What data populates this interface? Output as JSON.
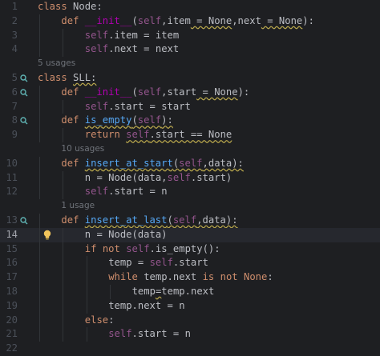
{
  "editor": {
    "lines": [
      {
        "kind": "code",
        "num": "1",
        "marker": false,
        "indent": 0,
        "tokens": [
          {
            "t": "class",
            "c": "kw"
          },
          {
            "t": " Node:"
          }
        ]
      },
      {
        "kind": "code",
        "num": "2",
        "marker": false,
        "indent": 1,
        "tokens": [
          {
            "t": "def",
            "c": "kw"
          },
          {
            "t": " "
          },
          {
            "t": "__init__",
            "c": "magic"
          },
          {
            "t": "("
          },
          {
            "t": "self",
            "c": "self"
          },
          {
            "t": ",item"
          },
          {
            "t": " = None",
            "c": "warn"
          },
          {
            "t": ",next"
          },
          {
            "t": " = None",
            "c": "warn"
          },
          {
            "t": "):"
          }
        ]
      },
      {
        "kind": "code",
        "num": "3",
        "marker": false,
        "indent": 2,
        "tokens": [
          {
            "t": "self",
            "c": "self"
          },
          {
            "t": ".item = item"
          }
        ]
      },
      {
        "kind": "code",
        "num": "4",
        "marker": false,
        "indent": 2,
        "tokens": [
          {
            "t": "self",
            "c": "self"
          },
          {
            "t": ".next = next"
          }
        ]
      },
      {
        "kind": "hint",
        "text": "5 usages",
        "indent": 0
      },
      {
        "kind": "code",
        "num": "5",
        "marker": true,
        "indent": 0,
        "tokens": [
          {
            "t": "class",
            "c": "kw"
          },
          {
            "t": " "
          },
          {
            "t": "SLL:",
            "c": "warn"
          }
        ]
      },
      {
        "kind": "code",
        "num": "6",
        "marker": true,
        "indent": 1,
        "tokens": [
          {
            "t": "def",
            "c": "kw"
          },
          {
            "t": " "
          },
          {
            "t": "__init__",
            "c": "magic"
          },
          {
            "t": "("
          },
          {
            "t": "self",
            "c": "self"
          },
          {
            "t": ",start"
          },
          {
            "t": " = None",
            "c": "warn"
          },
          {
            "t": "):"
          }
        ]
      },
      {
        "kind": "code",
        "num": "7",
        "marker": false,
        "indent": 2,
        "tokens": [
          {
            "t": "self",
            "c": "self"
          },
          {
            "t": ".start = start"
          }
        ]
      },
      {
        "kind": "code",
        "num": "8",
        "marker": true,
        "indent": 1,
        "tokens": [
          {
            "t": "def",
            "c": "kw"
          },
          {
            "t": " "
          },
          {
            "t": "is_empty",
            "c": "fn warn"
          },
          {
            "t": "(",
            "c": "warn"
          },
          {
            "t": "self",
            "c": "self warn"
          },
          {
            "t": "):",
            "c": "warn"
          }
        ]
      },
      {
        "kind": "code",
        "num": "9",
        "marker": false,
        "indent": 2,
        "tokens": [
          {
            "t": "return",
            "c": "kw"
          },
          {
            "t": " "
          },
          {
            "t": "self",
            "c": "self warn"
          },
          {
            "t": ".start == None",
            "c": "warn"
          }
        ]
      },
      {
        "kind": "hint",
        "text": "10 usages",
        "indent": 1
      },
      {
        "kind": "code",
        "num": "10",
        "marker": false,
        "indent": 1,
        "tokens": [
          {
            "t": "def",
            "c": "kw"
          },
          {
            "t": " "
          },
          {
            "t": "insert_at_start",
            "c": "fn warn"
          },
          {
            "t": "(",
            "c": "warn"
          },
          {
            "t": "self",
            "c": "self warn"
          },
          {
            "t": ",data):",
            "c": "warn"
          }
        ]
      },
      {
        "kind": "code",
        "num": "11",
        "marker": false,
        "indent": 2,
        "tokens": [
          {
            "t": "n = Node(data,"
          },
          {
            "t": "self",
            "c": "self"
          },
          {
            "t": ".start)"
          }
        ]
      },
      {
        "kind": "code",
        "num": "12",
        "marker": false,
        "indent": 2,
        "tokens": [
          {
            "t": "self",
            "c": "self"
          },
          {
            "t": ".start = n"
          }
        ]
      },
      {
        "kind": "hint",
        "text": "1 usage",
        "indent": 1
      },
      {
        "kind": "code",
        "num": "13",
        "marker": true,
        "indent": 1,
        "tokens": [
          {
            "t": "def",
            "c": "kw"
          },
          {
            "t": " "
          },
          {
            "t": "insert_at_last",
            "c": "fn warn"
          },
          {
            "t": "(",
            "c": "warn"
          },
          {
            "t": "self",
            "c": "self warn"
          },
          {
            "t": ",data):",
            "c": "warn"
          }
        ]
      },
      {
        "kind": "code",
        "num": "14",
        "marker": false,
        "indent": 2,
        "current": true,
        "bulb": true,
        "tokens": [
          {
            "t": "n = Node(data)"
          }
        ]
      },
      {
        "kind": "code",
        "num": "15",
        "marker": false,
        "indent": 2,
        "tokens": [
          {
            "t": "if",
            "c": "kw"
          },
          {
            "t": " "
          },
          {
            "t": "not",
            "c": "kw"
          },
          {
            "t": " "
          },
          {
            "t": "self",
            "c": "self"
          },
          {
            "t": ".is_empty():"
          }
        ]
      },
      {
        "kind": "code",
        "num": "16",
        "marker": false,
        "indent": 3,
        "tokens": [
          {
            "t": "temp = "
          },
          {
            "t": "self",
            "c": "self"
          },
          {
            "t": ".start"
          }
        ]
      },
      {
        "kind": "code",
        "num": "17",
        "marker": false,
        "indent": 3,
        "tokens": [
          {
            "t": "while",
            "c": "kw"
          },
          {
            "t": " temp.next "
          },
          {
            "t": "is",
            "c": "kw"
          },
          {
            "t": " "
          },
          {
            "t": "not",
            "c": "kw"
          },
          {
            "t": " "
          },
          {
            "t": "None",
            "c": "kw"
          },
          {
            "t": ":"
          }
        ]
      },
      {
        "kind": "code",
        "num": "18",
        "marker": false,
        "indent": 4,
        "tokens": [
          {
            "t": "temp"
          },
          {
            "t": "=",
            "c": "warn"
          },
          {
            "t": "temp.next"
          }
        ]
      },
      {
        "kind": "code",
        "num": "19",
        "marker": false,
        "indent": 3,
        "tokens": [
          {
            "t": "temp.next = n"
          }
        ]
      },
      {
        "kind": "code",
        "num": "20",
        "marker": false,
        "indent": 2,
        "tokens": [
          {
            "t": "else",
            "c": "kw"
          },
          {
            "t": ":"
          }
        ]
      },
      {
        "kind": "code",
        "num": "21",
        "marker": false,
        "indent": 3,
        "tokens": [
          {
            "t": "self",
            "c": "self"
          },
          {
            "t": ".start = n"
          }
        ]
      },
      {
        "kind": "code",
        "num": "22",
        "marker": false,
        "indent": 0,
        "tokens": []
      }
    ],
    "colors": {
      "background": "#1e1f22",
      "keyword": "#cf8e6d",
      "function": "#56a8f5",
      "self": "#94558d",
      "magic": "#b200b2",
      "hint": "#6f737a",
      "warning_underline": "#bba94d",
      "gutter_marker": "#5fb3b3",
      "bulb": "#f2c55c"
    },
    "icons": {
      "gutter_marker": "implementation-marker-icon",
      "bulb": "intention-bulb-icon"
    }
  }
}
